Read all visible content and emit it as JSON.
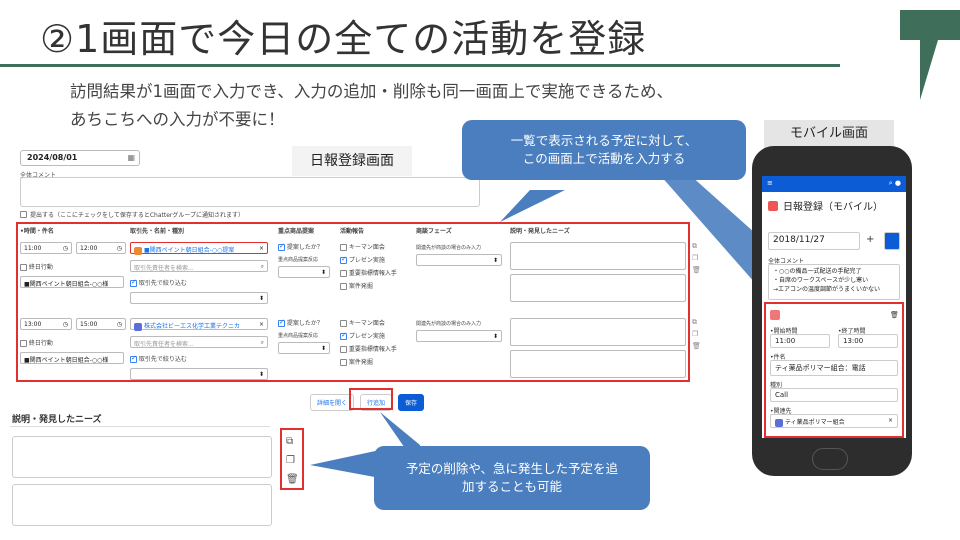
{
  "slide": {
    "title": "②1画面で今日の全ての活動を登録",
    "subtitle_line1": "訪問結果が1画面で入力でき、入力の追加・削除も同一画面上で実施できるため、",
    "subtitle_line2": "あちこちへの入力が不要に！",
    "accent_color": "#3f6f5a"
  },
  "screen": {
    "label": "日報登録画面",
    "date": "2024/08/01",
    "comment_label": "全体コメント",
    "notify_label": "提出する（ここにチェックをして保存するとChatterグループに通知されます）",
    "headers": {
      "time": "•時間・件名",
      "customer": "取引先・名前・種別",
      "product": "重点商品提案",
      "activity": "活動報告",
      "phase": "商談フェーズ",
      "needs": "説明・発見したニーズ"
    },
    "rows": [
      {
        "start": "11:00",
        "end": "12:00",
        "allday": "終日行動",
        "subject": "■関西ペイント朝日組合-○○様",
        "account": "■関西ペイント朝日組合-○○提案",
        "search_placeholder": "取引先責任者を検索...",
        "filter": "取引先で絞り込む",
        "proposal_q": "提案したか？",
        "reaction_lbl": "重点商品提案反応",
        "act1": "キーマン面会",
        "act2": "プレゼン実施",
        "act3": "重要指標情報入手",
        "act4": "案件発掘",
        "phase_note": "関連先が商談の場合のみ入力"
      },
      {
        "start": "13:00",
        "end": "15:00",
        "allday": "終日行動",
        "subject": "■関西ペイント朝日組合-○○様",
        "account": "株式会社ビーエス化学工業テクニカ",
        "search_placeholder": "取引先責任者を検索...",
        "filter": "取引先で絞り込む",
        "proposal_q": "提案したか？",
        "reaction_lbl": "重点商品提案反応",
        "act1": "キーマン面会",
        "act2": "プレゼン実施",
        "act3": "重要指標情報入手",
        "act4": "案件発掘",
        "phase_note": "関連先が商談の場合のみ入力"
      }
    ],
    "buttons": {
      "details": "詳細を開く",
      "add_row": "行追加",
      "save": "保存"
    },
    "needs_title": "説明・発見したニーズ"
  },
  "callouts": {
    "top": "一覧で表示される予定に対して、\nこの画面上で活動を入力する",
    "bottom": "予定の削除や、急に発生した予定を追\n加することも可能"
  },
  "mobile": {
    "label": "モバイル画面",
    "title": "日報登録（モバイル）",
    "date": "2018/11/27",
    "comment_label": "全体コメント",
    "comment_text1": "・○○の備品一式配送の手配完了",
    "comment_text2": "・自席のワークスペースが少し寒い",
    "comment_text3": "→エアコンの温度調節がうまくいかない",
    "start_lbl": "•開始時間",
    "end_lbl": "•終了時間",
    "start": "11:00",
    "end": "13:00",
    "subject_lbl": "•件名",
    "subject": "ティ薬品ポリマー組合：電話",
    "type_lbl": "種別",
    "type": "Call",
    "related_lbl": "•関連先",
    "related": "ティ薬品ポリマー組合"
  }
}
